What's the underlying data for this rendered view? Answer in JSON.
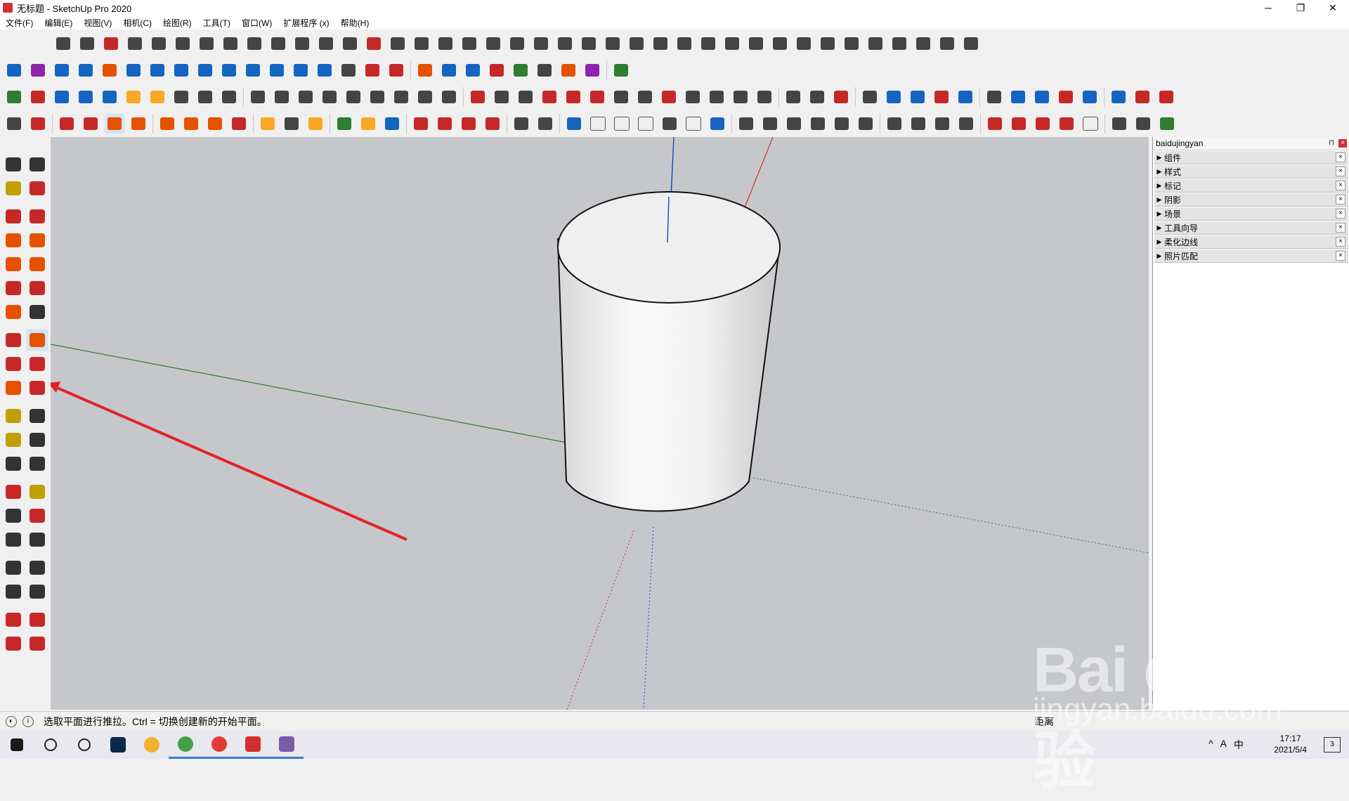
{
  "window": {
    "title": "无标题 - SketchUp Pro 2020",
    "controls": [
      "─",
      "❐",
      "✕"
    ]
  },
  "menu": [
    "文件(F)",
    "编辑(E)",
    "视图(V)",
    "相机(C)",
    "绘图(R)",
    "工具(T)",
    "窗口(W)",
    "扩展程序 (x)",
    "帮助(H)"
  ],
  "tray": {
    "title": "baidujingyan",
    "pin": "⊓",
    "close": "×",
    "panels": [
      "组件",
      "样式",
      "标记",
      "阴影",
      "场景",
      "工具向导",
      "柔化边线",
      "照片匹配"
    ]
  },
  "status": {
    "hint": "选取平面进行推拉。Ctrl = 切换创建新的开始平面。",
    "measurement_label": "距离"
  },
  "taskbar": {
    "time": "17:17",
    "date": "2021/5/4",
    "notifications": "3",
    "system_tray": [
      "^",
      "A",
      "中"
    ]
  },
  "watermark": {
    "brand": "Bai du 经验",
    "url": "jingyan.baidu.com"
  },
  "colors": {
    "viewport_bg": "#c6c7cb",
    "red_axis": "#d32f2f",
    "green_axis": "#2e7d32",
    "blue_axis": "#1e3fc8",
    "annotation_arrow": "#e02424",
    "active_tool": "#cfe4f7"
  },
  "toolbars": {
    "active_tool": "push-pull-tool"
  }
}
